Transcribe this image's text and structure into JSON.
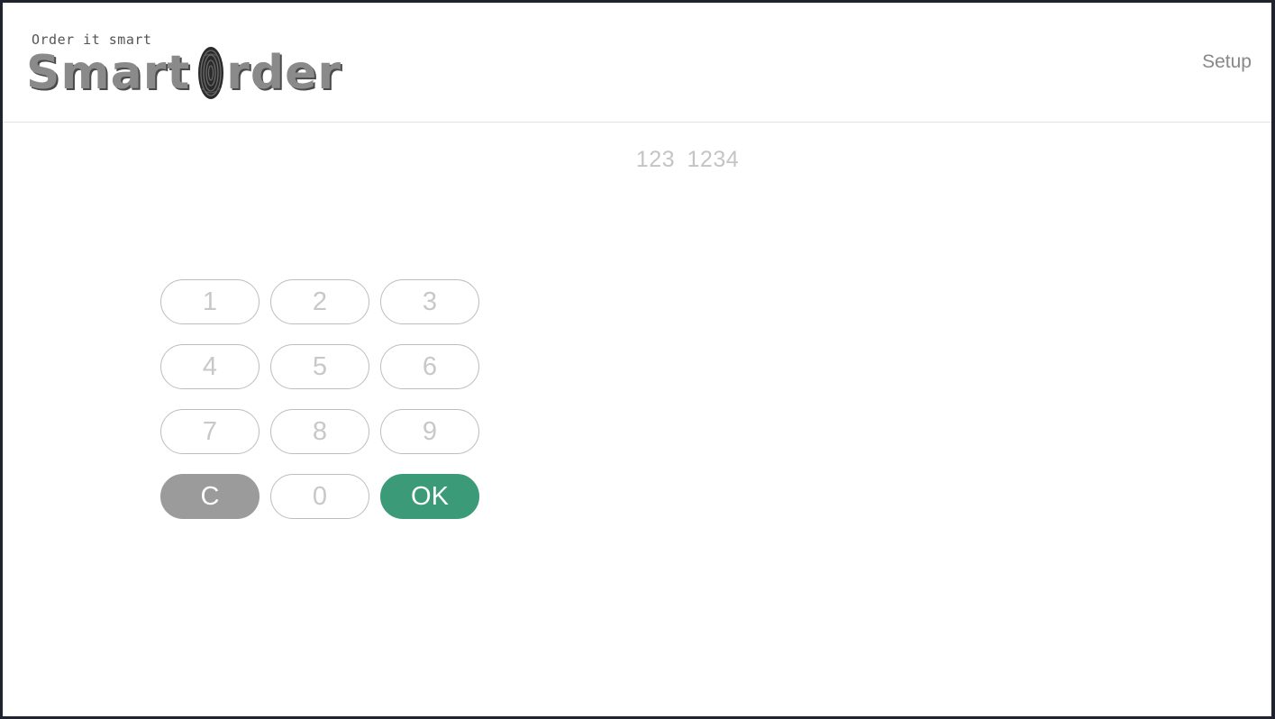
{
  "header": {
    "logo": {
      "tagline": "Order it smart",
      "brand_prefix": "Smart",
      "brand_suffix": "rder"
    },
    "setup_label": "Setup"
  },
  "pin_display": {
    "text": "123  1234"
  },
  "keypad": {
    "keys": [
      "1",
      "2",
      "3",
      "4",
      "5",
      "6",
      "7",
      "8",
      "9"
    ],
    "clear_label": "C",
    "zero_label": "0",
    "ok_label": "OK"
  },
  "colors": {
    "ok_button": "#3b9b78",
    "clear_button": "#9b9b9b",
    "key_border": "#bdbdbd",
    "key_text": "#c8c8c8"
  },
  "icons": {
    "logo_mark": "fingerprint-icon"
  }
}
